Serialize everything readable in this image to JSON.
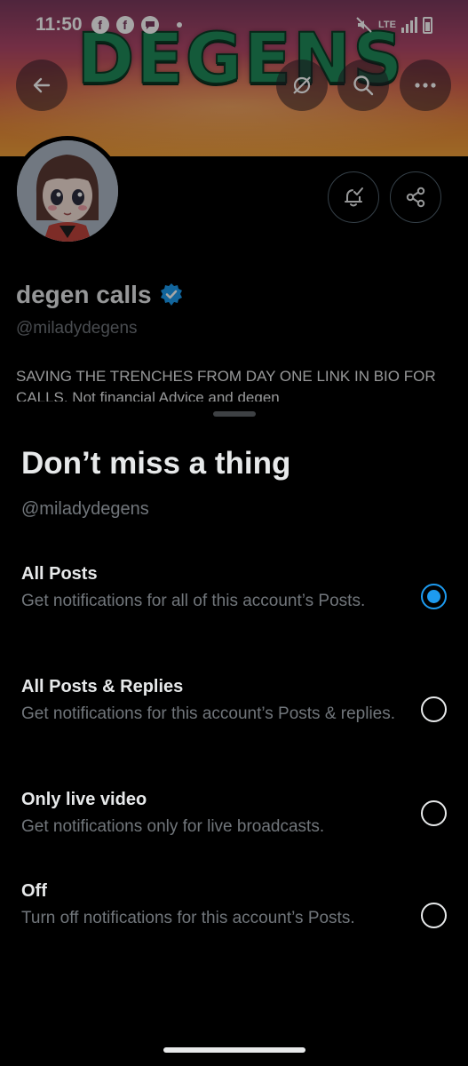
{
  "status_bar": {
    "time": "11:50",
    "network": "LTE"
  },
  "banner": {
    "title": "DEGENS"
  },
  "profile": {
    "name": "degen calls",
    "handle": "@miladydegens",
    "bio": "SAVING THE TRENCHES FROM DAY ONE LINK IN BIO FOR CALLS. Not financial Advice and degen"
  },
  "sheet": {
    "title": "Don’t miss a thing",
    "handle": "@miladydegens",
    "options": [
      {
        "title": "All Posts",
        "description": "Get notifications for all of this account’s Posts.",
        "selected": true
      },
      {
        "title": "All Posts & Replies",
        "description": "Get notifications for this account’s Posts & replies.",
        "selected": false
      },
      {
        "title": "Only live video",
        "description": "Get notifications only for live broadcasts.",
        "selected": false
      },
      {
        "title": "Off",
        "description": "Turn off notifications for this account’s Posts.",
        "selected": false
      }
    ]
  },
  "colors": {
    "accent": "#1d9bf0",
    "secondary_text": "#71767b",
    "background": "#000000"
  }
}
